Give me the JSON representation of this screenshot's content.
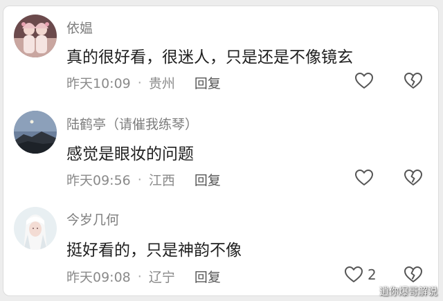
{
  "colors": {
    "username": "#7d7d7d",
    "content": "#1f1f1f",
    "meta": "#8a8a8a",
    "icon_stroke": "#555555",
    "card_bg": "#ffffff",
    "page_bg": "#ededed"
  },
  "comments": [
    {
      "username": "依媪",
      "content": "真的很好看，很迷人，只是还是不像镜玄",
      "time": "昨天10:09",
      "location": "贵州",
      "reply_label": "回复",
      "separator": "·",
      "likes": "",
      "like_icon": "heart-outline-icon",
      "dislike_icon": "broken-heart-icon"
    },
    {
      "username": "陆鹤亭（请催我练琴）",
      "content": "感觉是眼妆的问题",
      "time": "昨天09:56",
      "location": "江西",
      "reply_label": "回复",
      "separator": "·",
      "likes": "",
      "like_icon": "heart-outline-icon",
      "dislike_icon": "broken-heart-icon"
    },
    {
      "username": "今岁几何",
      "content": "挺好看的，只是神韵不像",
      "time": "昨天09:08",
      "location": "辽宁",
      "reply_label": "回复",
      "separator": "·",
      "likes": "2",
      "like_icon": "heart-outline-icon",
      "dislike_icon": "broken-heart-icon"
    }
  ],
  "watermark": "逍你爆哥解说"
}
